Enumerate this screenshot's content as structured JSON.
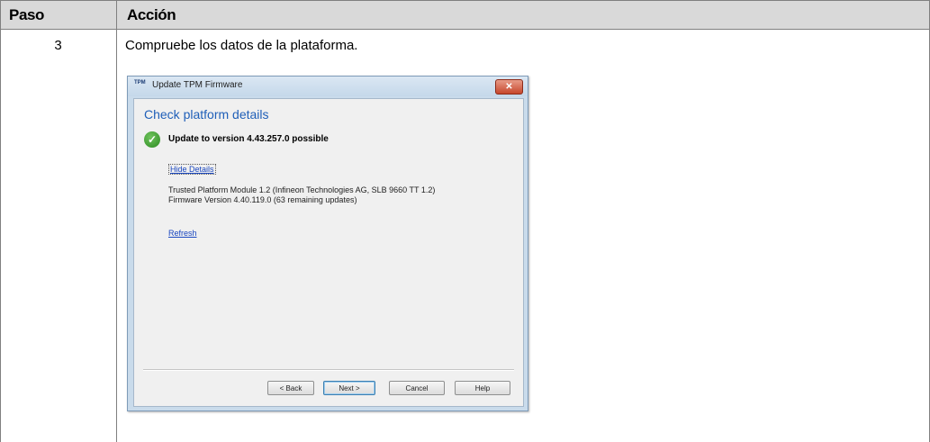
{
  "table": {
    "header": {
      "paso": "Paso",
      "accion": "Acción"
    },
    "rows": [
      {
        "paso": "3",
        "accion": "Compruebe los datos de la plataforma."
      }
    ]
  },
  "dialog": {
    "icon_text": "TPM",
    "title": "Update TPM Firmware",
    "close_label": "✕",
    "heading": "Check platform details",
    "status": "Update to version 4.43.257.0 possible",
    "hide_details_link": "Hide Details",
    "detail_lines": [
      "Trusted Platform Module 1.2 (Infineon Technologies AG, SLB 9660 TT 1.2)",
      "Firmware Version 4.40.119.0 (63 remaining updates)"
    ],
    "refresh_link": "Refresh",
    "buttons": {
      "back": "< Back",
      "next": "Next >",
      "cancel": "Cancel",
      "help": "Help"
    }
  },
  "colors": {
    "header_bg": "#d9d9d9",
    "heading_blue": "#1f5fb8",
    "link_blue": "#1a47c0",
    "success_green": "#2c8a22"
  },
  "icons": {
    "success": "check-circle-icon",
    "close": "close-icon",
    "app": "tpm-app-icon"
  }
}
